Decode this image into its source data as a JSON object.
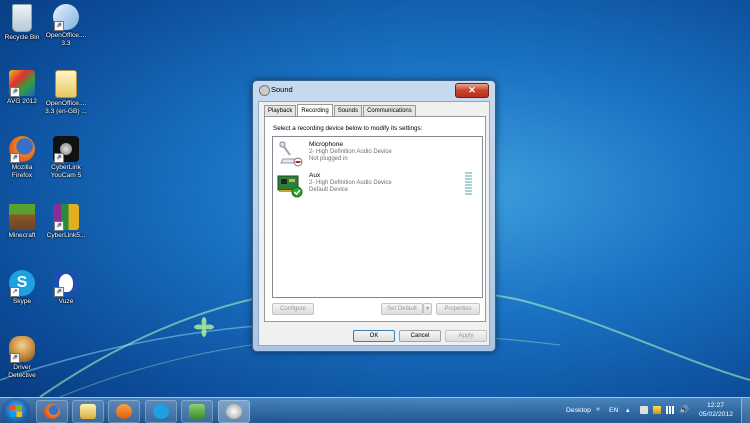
{
  "desktop": {
    "icons": [
      {
        "label1": "Recycle Bin",
        "label2": ""
      },
      {
        "label1": "OpenOffice....",
        "label2": "3.3"
      },
      {
        "label1": "AVG 2012",
        "label2": ""
      },
      {
        "label1": "OpenOffice....",
        "label2": "3.3 (en-GB) ..."
      },
      {
        "label1": "Mozilla",
        "label2": "Firefox"
      },
      {
        "label1": "CyberLink",
        "label2": "YouCam 5"
      },
      {
        "label1": "Minecraft",
        "label2": ""
      },
      {
        "label1": "CyberLink5...",
        "label2": ""
      },
      {
        "label1": "Skype",
        "label2": ""
      },
      {
        "label1": "Vuze",
        "label2": ""
      },
      {
        "label1": "Driver",
        "label2": "Detective"
      }
    ]
  },
  "dialog": {
    "title": "Sound",
    "close_label": "✕",
    "tabs": [
      "Playback",
      "Recording",
      "Sounds",
      "Communications"
    ],
    "active_tab": "Recording",
    "instruction": "Select a recording device below to modify its settings:",
    "devices": [
      {
        "name": "Microphone",
        "line1": "2- High Definition Audio Device",
        "line2": "Not plugged in"
      },
      {
        "name": "Aux",
        "line1": "2- High Definition Audio Device",
        "line2": "Default Device"
      }
    ],
    "buttons": {
      "configure": "Configure",
      "set_default": "Set Default",
      "properties": "Properties",
      "ok": "OK",
      "cancel": "Cancel",
      "apply": "Apply"
    }
  },
  "taskbar": {
    "desktop_label": "Desktop",
    "language": "EN",
    "time": "12:27",
    "date": "05/02/2012"
  },
  "colors": {
    "desktop_blue": "#1a73c4",
    "taskbar": "#2a5a8c",
    "default_check": "#2ea52e"
  }
}
